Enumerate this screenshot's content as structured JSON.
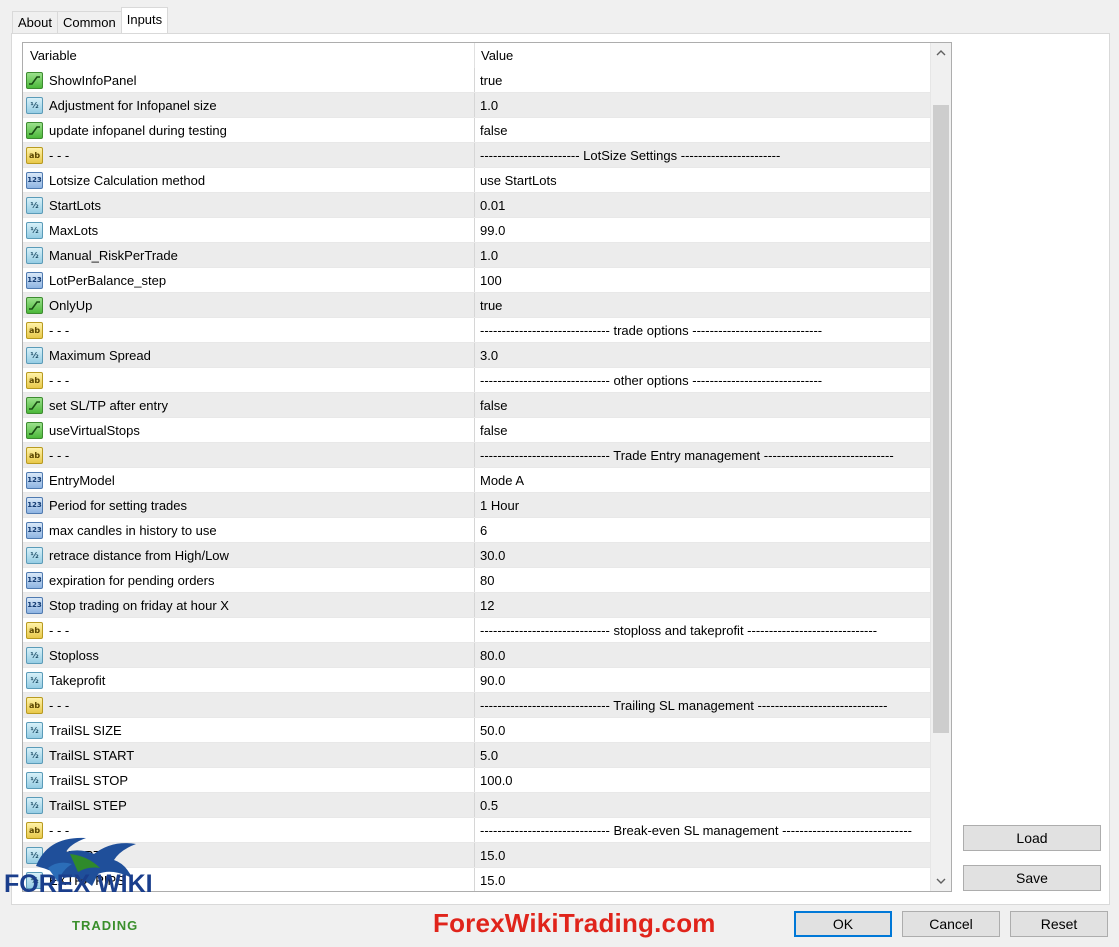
{
  "tabs": [
    "About",
    "Common",
    "Inputs"
  ],
  "columns": {
    "variable": "Variable",
    "value": "Value"
  },
  "rows": [
    {
      "type": "bool",
      "name": "ShowInfoPanel",
      "value": "true"
    },
    {
      "type": "double",
      "name": "Adjustment for Infopanel size",
      "value": "1.0"
    },
    {
      "type": "bool",
      "name": "update infopanel during testing",
      "value": "false"
    },
    {
      "type": "string",
      "name": "- - -",
      "value": "----------------------- LotSize Settings -----------------------"
    },
    {
      "type": "int",
      "name": "Lotsize Calculation method",
      "value": "use StartLots"
    },
    {
      "type": "double",
      "name": "StartLots",
      "value": "0.01"
    },
    {
      "type": "double",
      "name": "MaxLots",
      "value": "99.0"
    },
    {
      "type": "double",
      "name": "Manual_RiskPerTrade",
      "value": "1.0"
    },
    {
      "type": "int",
      "name": "LotPerBalance_step",
      "value": "100"
    },
    {
      "type": "bool",
      "name": "OnlyUp",
      "value": "true"
    },
    {
      "type": "string",
      "name": "- - -",
      "value": "------------------------------ trade options ------------------------------"
    },
    {
      "type": "double",
      "name": "Maximum Spread",
      "value": "3.0"
    },
    {
      "type": "string",
      "name": "- - -",
      "value": "------------------------------ other options ------------------------------"
    },
    {
      "type": "bool",
      "name": "set SL/TP after entry",
      "value": "false"
    },
    {
      "type": "bool",
      "name": "useVirtualStops",
      "value": "false"
    },
    {
      "type": "string",
      "name": "- - -",
      "value": "------------------------------ Trade Entry management ------------------------------"
    },
    {
      "type": "int",
      "name": "EntryModel",
      "value": "Mode A"
    },
    {
      "type": "int",
      "name": "Period for setting trades",
      "value": "1 Hour"
    },
    {
      "type": "int",
      "name": "max candles in history to use",
      "value": "6"
    },
    {
      "type": "double",
      "name": "retrace distance from High/Low",
      "value": "30.0"
    },
    {
      "type": "int",
      "name": "expiration for pending orders",
      "value": "80"
    },
    {
      "type": "int",
      "name": "Stop trading on friday at hour X",
      "value": "12"
    },
    {
      "type": "string",
      "name": "- - -",
      "value": "------------------------------ stoploss and takeprofit ------------------------------"
    },
    {
      "type": "double",
      "name": "Stoploss",
      "value": "80.0"
    },
    {
      "type": "double",
      "name": "Takeprofit",
      "value": "90.0"
    },
    {
      "type": "string",
      "name": "- - -",
      "value": "------------------------------ Trailing SL management ------------------------------"
    },
    {
      "type": "double",
      "name": "TrailSL SIZE",
      "value": "50.0"
    },
    {
      "type": "double",
      "name": "TrailSL START",
      "value": "5.0"
    },
    {
      "type": "double",
      "name": "TrailSL STOP",
      "value": "100.0"
    },
    {
      "type": "double",
      "name": "TrailSL STEP",
      "value": "0.5"
    },
    {
      "type": "string",
      "name": "- - -",
      "value": "------------------------------ Break-even SL management ------------------------------"
    },
    {
      "type": "double",
      "name": "n START",
      "value": "15.0"
    },
    {
      "type": "double",
      "name": "EXTRA PIPS",
      "value": "15.0"
    }
  ],
  "icons": {
    "bool": "bool-icon",
    "double": "double-icon",
    "int": "integer-icon",
    "string": "string-icon"
  },
  "buttons": {
    "load": "Load",
    "save": "Save",
    "ok": "OK",
    "cancel": "Cancel",
    "reset": "Reset"
  },
  "watermark": {
    "site": "ForexWikiTrading.com",
    "logo_main": "FOREX WIKI",
    "logo_sub": "TRADING"
  }
}
